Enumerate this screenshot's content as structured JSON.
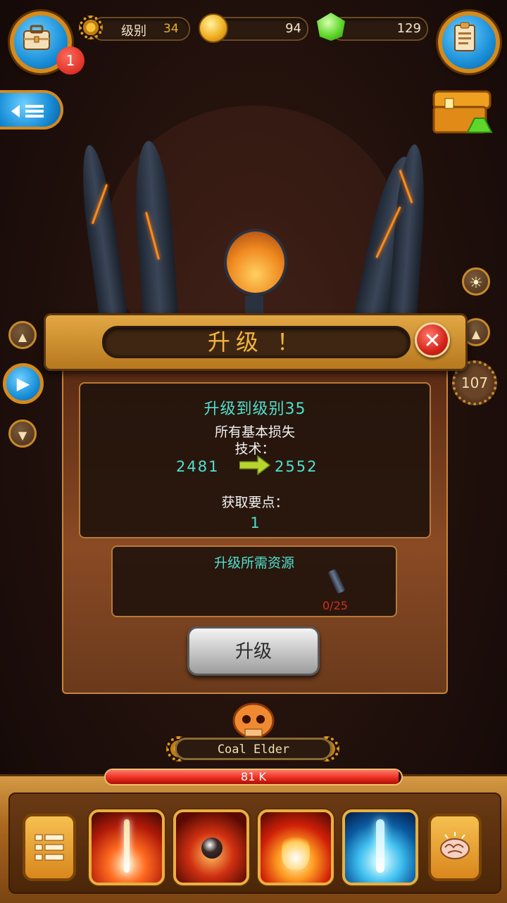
{
  "top_bar": {
    "inventory_badge": "1",
    "level_label": "级别",
    "level_value": "34",
    "coins": "94",
    "gems": "129"
  },
  "side": {
    "counter": "107"
  },
  "dialog": {
    "title": "升级  ！",
    "close_glyph": "✕",
    "upgrade_to": "升级到级别35",
    "line_all_damage": "所有基本损失",
    "line_tech": "技术：",
    "from_value": "2481",
    "to_value": "2552",
    "points_label": "获取要点：",
    "points_value": "1",
    "resources_label": "升级所需资源",
    "resource_count": "0/25",
    "upgrade_button": "升级"
  },
  "boss": {
    "name": "Coal Elder",
    "hp_text": "81 K",
    "hp_fraction": 0.99
  },
  "icons": [
    "toolbox-icon",
    "gear-icon",
    "coin-icon",
    "gem-icon",
    "clipboard-icon",
    "back-menu-icon",
    "treasure-chest-icon",
    "sun-icon",
    "arrow-up-icon",
    "play-icon",
    "arrow-down-icon",
    "close-icon",
    "coal-item-icon",
    "skull-icon",
    "list-icon",
    "brain-icon"
  ]
}
